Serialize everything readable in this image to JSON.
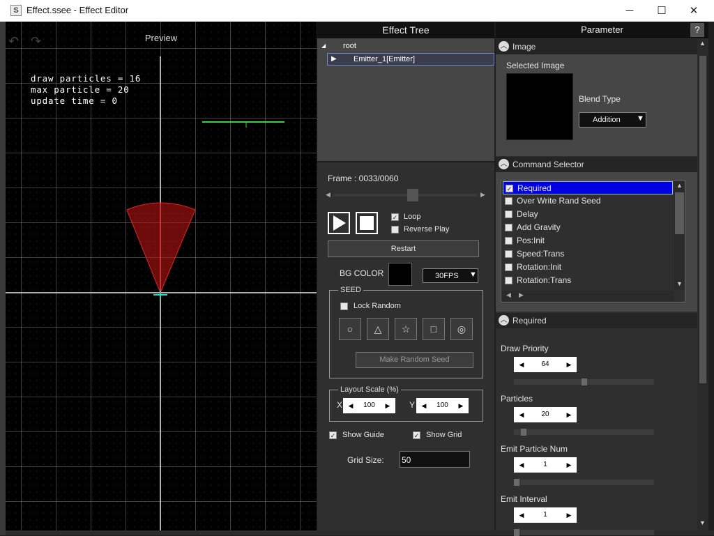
{
  "window": {
    "title": "Effect.ssee - Effect Editor",
    "app_icon": "S",
    "minimize": "─",
    "maximize": "☐",
    "close": "✕"
  },
  "preview": {
    "header": "Preview",
    "undo_icon": "↶",
    "redo_icon": "↷",
    "stats": [
      "draw particles = 16",
      "max particle = 20",
      "update time = 0"
    ]
  },
  "tree": {
    "header": "Effect Tree",
    "root": "root",
    "emitter": "Emitter_1[Emitter]"
  },
  "playback": {
    "frame_label": "Frame : 0033/0060",
    "frame_current": 33,
    "frame_total": 60,
    "loop": "Loop",
    "reverse": "Reverse Play",
    "restart": "Restart",
    "bg_label": "BG COLOR",
    "bg_color": "#000000",
    "fps": "30FPS",
    "seed_title": "SEED",
    "lock_random": "Lock Random",
    "seed_icons": [
      "○",
      "△",
      "☆",
      "□",
      "◎"
    ],
    "make_seed": "Make Random Seed",
    "layout_title": "Layout Scale (%)",
    "x_label": "X",
    "x_value": "100",
    "y_label": "Y",
    "y_value": "100",
    "show_guide": "Show Guide",
    "show_grid": "Show Grid",
    "grid_size_label": "Grid Size:",
    "grid_size": "50"
  },
  "param": {
    "header": "Parameter",
    "help": "?",
    "image_section": "Image",
    "selected_image": "Selected Image",
    "blend_type": "Blend Type",
    "blend_value": "Addition",
    "command_section": "Command Selector",
    "commands": [
      {
        "name": "Required",
        "checked": true
      },
      {
        "name": "Over Write Rand Seed",
        "checked": false
      },
      {
        "name": "Delay",
        "checked": false
      },
      {
        "name": "Add Gravity",
        "checked": false
      },
      {
        "name": "Pos:Init",
        "checked": false
      },
      {
        "name": "Speed:Trans",
        "checked": false
      },
      {
        "name": "Rotation:Init",
        "checked": false
      },
      {
        "name": "Rotation:Trans",
        "checked": false
      }
    ],
    "required_section": "Required",
    "fields": [
      {
        "label": "Draw Priority",
        "value": "64",
        "level": 0.5
      },
      {
        "label": "Particles",
        "value": "20",
        "level": 0.05
      },
      {
        "label": "Emit Particle Num",
        "value": "1",
        "level": 0.0
      },
      {
        "label": "Emit Interval",
        "value": "1",
        "level": 0.0
      }
    ]
  }
}
